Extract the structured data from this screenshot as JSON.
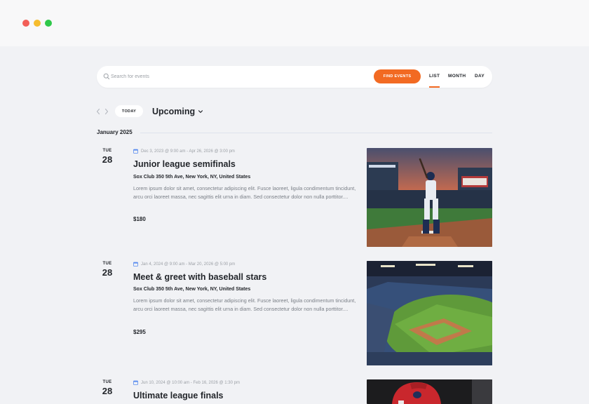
{
  "window": {
    "controls": [
      "close",
      "minimize",
      "maximize"
    ]
  },
  "search": {
    "placeholder": "Search for events",
    "value": "",
    "icon": "search-icon",
    "button_label": "FIND EVENTS"
  },
  "views": {
    "tabs": [
      {
        "label": "LIST",
        "active": true
      },
      {
        "label": "MONTH",
        "active": false
      },
      {
        "label": "DAY",
        "active": false
      }
    ]
  },
  "nav": {
    "prev_icon": "chevron-left-icon",
    "next_icon": "chevron-right-icon",
    "today_label": "TODAY",
    "range_label": "Upcoming",
    "range_icon": "chevron-down-icon"
  },
  "month_label": "January 2025",
  "colors": {
    "accent": "#f26a22",
    "background": "#f1f2f5",
    "muted_text": "#9ca0a6",
    "calendar_icon": "#5b8def"
  },
  "events": [
    {
      "dow": "TUE",
      "dom": "28",
      "date_range": "Dec 3, 2023 @ 9:00 am - Apr 26, 2026 @ 3:00 pm",
      "title": "Junior league semifinals",
      "venue": "Sox Club 350 5th Ave, New York, NY, United States",
      "description": "Lorem ipsum dolor sit amet, consectetur adipiscing elit. Fusce laoreet, ligula condimentum tincidunt, arcu orci laoreet massa, nec sagittis elit urna in diam. Sed consectetur dolor non nulla porttitor....",
      "price": "$180",
      "image": "baseball-batter-photo"
    },
    {
      "dow": "TUE",
      "dom": "28",
      "date_range": "Jan 4, 2024 @ 9:00 am - Mar 20, 2026 @ 5:00 pm",
      "title": "Meet & greet with baseball stars",
      "venue": "Sox Club 350 5th Ave, New York, NY, United States",
      "description": "Lorem ipsum dolor sit amet, consectetur adipiscing elit. Fusce laoreet, ligula condimentum tincidunt, arcu orci laoreet massa, nec sagittis elit urna in diam. Sed consectetur dolor non nulla porttitor....",
      "price": "$295",
      "image": "baseball-stadium-photo"
    },
    {
      "dow": "TUE",
      "dom": "28",
      "date_range": "Jun 10, 2024 @ 10:00 am - Feb 16, 2026 @ 1:30 pm",
      "title": "Ultimate league finals",
      "image": "baseball-player-helmet-photo"
    }
  ]
}
